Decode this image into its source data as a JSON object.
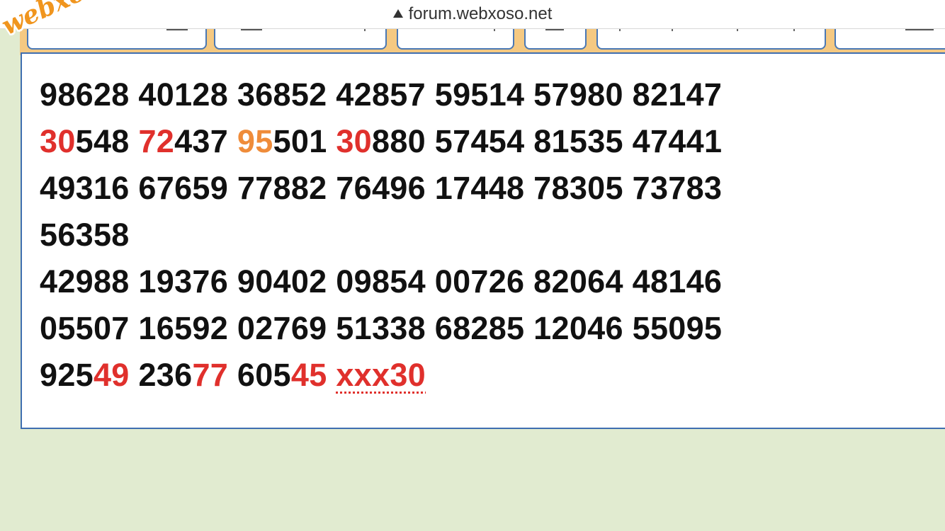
{
  "browser": {
    "url": "forum.webxoso.net"
  },
  "logo": {
    "text": "webxoso.net"
  },
  "rows": [
    [
      {
        "t": "98628 40128 36852 42857 59514 57980 82147"
      }
    ],
    [
      {
        "t": "30",
        "c": "r"
      },
      {
        "t": "548 "
      },
      {
        "t": "72",
        "c": "r"
      },
      {
        "t": "437 "
      },
      {
        "t": "95",
        "c": "o"
      },
      {
        "t": "501 "
      },
      {
        "t": "30",
        "c": "r"
      },
      {
        "t": "880 57454 81535 47441"
      }
    ],
    [
      {
        "t": "49316 67659 77882 76496 17448 78305 73783"
      }
    ],
    [
      {
        "t": "56358"
      }
    ],
    [
      {
        "t": "42988 19376 90402 09854 00726 82064 48146"
      }
    ],
    [
      {
        "t": "05507 16592 02769 51338 68285 12046 55095"
      }
    ],
    [
      {
        "t": "925"
      },
      {
        "t": "49",
        "c": "r"
      },
      {
        "t": " 236"
      },
      {
        "t": "77",
        "c": "r"
      },
      {
        "t": " 605"
      },
      {
        "t": "45",
        "c": "r"
      },
      {
        "t": " "
      },
      {
        "t": "xxx30",
        "c": "dot"
      }
    ]
  ]
}
